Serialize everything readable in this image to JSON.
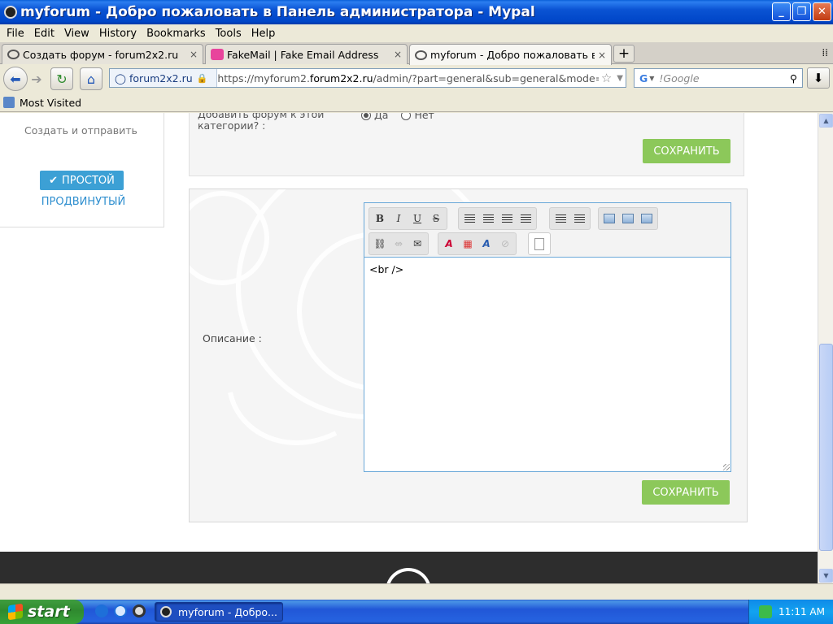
{
  "window": {
    "title": "myforum - Добро пожаловать в Панель администратора - Mypal",
    "minimize": "_",
    "maximize": "❐",
    "close": "✕"
  },
  "menu": [
    "File",
    "Edit",
    "View",
    "History",
    "Bookmarks",
    "Tools",
    "Help"
  ],
  "tabs": [
    {
      "label": "Создать форум - forum2x2.ru",
      "close": "×"
    },
    {
      "label": "FakeMail | Fake Email Address",
      "close": "×"
    },
    {
      "label": "myforum - Добро пожаловать в ...",
      "close": "×"
    }
  ],
  "new_tab": "+",
  "nav": {
    "site_identity": "forum2x2.ru",
    "url_prefix": "https://myforum2.",
    "url_domain": "forum2x2.ru",
    "url_path": "/admin/?part=general&sub=general&mode=create&",
    "search_engine": "G",
    "search_placeholder": "!Google"
  },
  "bookmarks": {
    "most_visited": "Most Visited"
  },
  "sidebar": {
    "create_and_send": "Создать и отправить",
    "simple_button": "ПРОСТОЙ",
    "advanced_link": "ПРОДВИНУТЫЙ"
  },
  "form": {
    "add_forum_question": "Добавить форум к этой категории? :",
    "radio_yes": "Да",
    "radio_no": "Нет",
    "radio_yes_checked": true,
    "save_button_top": "СОХРАНИТЬ",
    "description_label": "Описание :",
    "editor_content": "<br />",
    "save_button_bottom": "СОХРАНИТЬ"
  },
  "editor_toolbar": {
    "bold": "B",
    "italic": "I",
    "underline": "U",
    "strike": "S",
    "font_color": "A",
    "font_style": "A"
  },
  "taskbar": {
    "start": "start",
    "window_item": "myforum - Добро...",
    "clock": "11:11 AM"
  },
  "colors": {
    "save_green": "#8cc85a",
    "simple_blue": "#3ca0d5",
    "editor_border": "#6aa8d8"
  }
}
